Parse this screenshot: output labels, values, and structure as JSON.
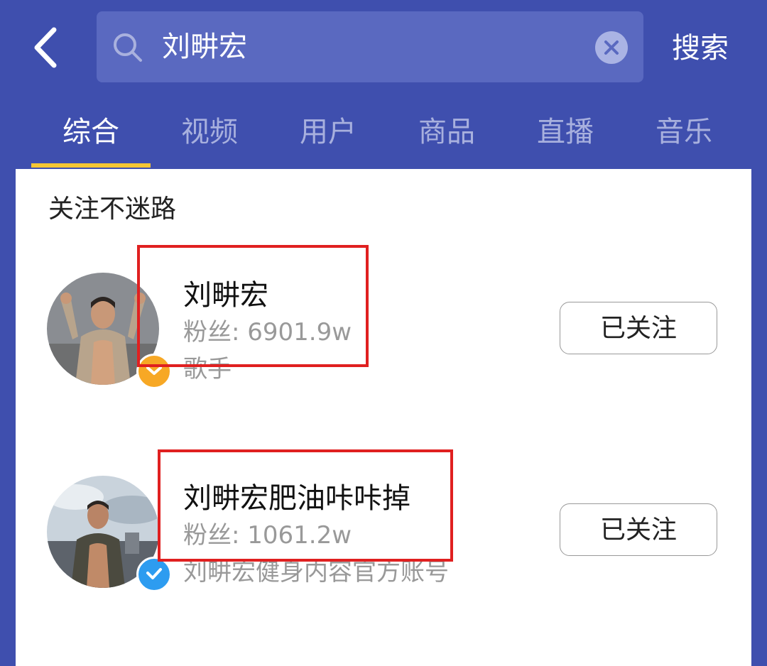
{
  "search": {
    "query": "刘畊宏",
    "button_label": "搜索"
  },
  "tabs": [
    {
      "label": "综合",
      "active": true
    },
    {
      "label": "视频",
      "active": false
    },
    {
      "label": "用户",
      "active": false
    },
    {
      "label": "商品",
      "active": false
    },
    {
      "label": "直播",
      "active": false
    },
    {
      "label": "音乐",
      "active": false
    }
  ],
  "section": {
    "title": "关注不迷路"
  },
  "users": [
    {
      "name": "刘畊宏",
      "fans": "粉丝: 6901.9w",
      "description": "歌手",
      "follow_label": "已关注",
      "badge_color": "#f7a825"
    },
    {
      "name": "刘畊宏肥油咔咔掉",
      "fans": "粉丝: 1061.2w",
      "description": "刘畊宏健身内容官方账号",
      "follow_label": "已关注",
      "badge_color": "#2d9cf0"
    }
  ],
  "colors": {
    "header_bg": "#3f4fae",
    "tab_indicator": "#f5c634",
    "highlight_box": "#e02020"
  }
}
